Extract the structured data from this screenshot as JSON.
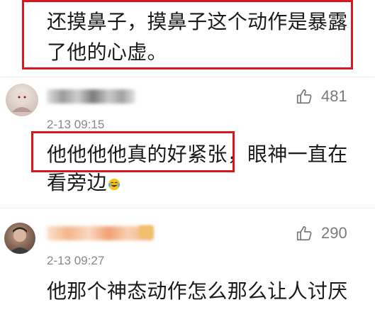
{
  "post": {
    "line1": "还摸鼻子，摸鼻子这个动作是暴露",
    "line2": "了他的心虚。"
  },
  "comments": [
    {
      "likes": "481",
      "timestamp": "2-13 09:15",
      "text_highlight": "他他他他真的好紧张，",
      "text_rest": "眼神一直在",
      "text_line2": "看旁边",
      "emoji": "laughing-crying-emoji"
    },
    {
      "likes": "290",
      "timestamp": "2-13 09:27",
      "text_line1": "他那个神态动作怎么那么让人讨厌"
    }
  ],
  "colors": {
    "highlight_border": "#d7191e",
    "meta_gray": "#888888"
  }
}
